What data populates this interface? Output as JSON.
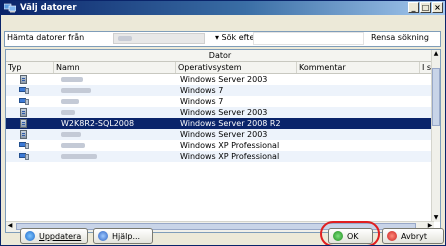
{
  "window": {
    "title": "Välj datorer",
    "minimize": "_",
    "maximize": "□",
    "close": "×"
  },
  "toolbar": {
    "fetch_label": "Hämta datorer från",
    "search_label": "▾ Sök efter",
    "clear_label": "Rensa sökning"
  },
  "grid": {
    "group_header": "Dator",
    "columns": {
      "type": "Typ",
      "name": "Namn",
      "os": "Operativsystem",
      "comment": "Kommentar",
      "extra": "I sys"
    },
    "rows": [
      {
        "icon": "server-icon",
        "name": "",
        "os": "Windows Server 2003",
        "selected": false
      },
      {
        "icon": "workstation-icon",
        "name": "",
        "os": "Windows 7",
        "selected": false
      },
      {
        "icon": "workstation-icon",
        "name": "",
        "os": "Windows 7",
        "selected": false
      },
      {
        "icon": "server-icon",
        "name": "",
        "os": "Windows Server 2003",
        "selected": false
      },
      {
        "icon": "server-icon",
        "name": "W2K8R2-SQL2008",
        "os": "Windows Server 2008 R2",
        "selected": true
      },
      {
        "icon": "server-icon",
        "name": "",
        "os": "Windows Server 2003",
        "selected": false
      },
      {
        "icon": "workstation-icon",
        "name": "",
        "os": "Windows XP Professional",
        "selected": false
      },
      {
        "icon": "workstation-icon",
        "name": "",
        "os": "Windows XP Professional",
        "selected": false
      }
    ]
  },
  "buttons": {
    "update": "Uppdatera",
    "help": "Hjälp...",
    "ok": "OK",
    "cancel": "Avbryt"
  }
}
